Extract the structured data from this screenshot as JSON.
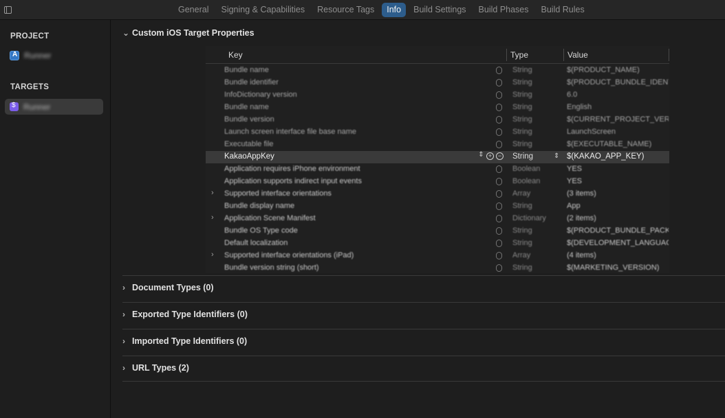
{
  "tabs": [
    "General",
    "Signing & Capabilities",
    "Resource Tags",
    "Info",
    "Build Settings",
    "Build Phases",
    "Build Rules"
  ],
  "active_tab": "Info",
  "sidebar": {
    "project_heading": "PROJECT",
    "project_name": "Runner",
    "targets_heading": "TARGETS",
    "target_name": "Runner"
  },
  "section": {
    "title": "Custom iOS Target Properties",
    "columns": {
      "key": "Key",
      "type": "Type",
      "value": "Value"
    },
    "rows": [
      {
        "key": "Bundle name",
        "type": "String",
        "value": "$(PRODUCT_NAME)",
        "expandable": false
      },
      {
        "key": "Bundle identifier",
        "type": "String",
        "value": "$(PRODUCT_BUNDLE_IDENTIFIER)",
        "expandable": false
      },
      {
        "key": "InfoDictionary version",
        "type": "String",
        "value": "6.0",
        "expandable": false
      },
      {
        "key": "Bundle name",
        "type": "String",
        "value": "English",
        "expandable": false
      },
      {
        "key": "Bundle version",
        "type": "String",
        "value": "$(CURRENT_PROJECT_VERSION)",
        "expandable": false
      },
      {
        "key": "Launch screen interface file base name",
        "type": "String",
        "value": "LaunchScreen",
        "expandable": false
      },
      {
        "key": "Executable file",
        "type": "String",
        "value": "$(EXECUTABLE_NAME)",
        "expandable": false
      },
      {
        "key": "KakaoAppKey",
        "type": "String",
        "value": "$(KAKAO_APP_KEY)",
        "expandable": false,
        "selected": true
      },
      {
        "key": "Application requires iPhone environment",
        "type": "Boolean",
        "value": "YES",
        "expandable": false
      },
      {
        "key": "Application supports indirect input events",
        "type": "Boolean",
        "value": "YES",
        "expandable": false
      },
      {
        "key": "Supported interface orientations",
        "type": "Array",
        "value": "(3 items)",
        "expandable": true
      },
      {
        "key": "Bundle display name",
        "type": "String",
        "value": "App",
        "expandable": false
      },
      {
        "key": "Application Scene Manifest",
        "type": "Dictionary",
        "value": "(2 items)",
        "expandable": true
      },
      {
        "key": "Bundle OS Type code",
        "type": "String",
        "value": "$(PRODUCT_BUNDLE_PACKAGE_TYPE)",
        "expandable": false
      },
      {
        "key": "Default localization",
        "type": "String",
        "value": "$(DEVELOPMENT_LANGUAGE)",
        "expandable": false
      },
      {
        "key": "Supported interface orientations (iPad)",
        "type": "Array",
        "value": "(4 items)",
        "expandable": true
      },
      {
        "key": "Bundle version string (short)",
        "type": "String",
        "value": "$(MARKETING_VERSION)",
        "expandable": false
      }
    ]
  },
  "collapsed_sections": [
    "Document Types (0)",
    "Exported Type Identifiers (0)",
    "Imported Type Identifiers (0)",
    "URL Types (2)"
  ]
}
